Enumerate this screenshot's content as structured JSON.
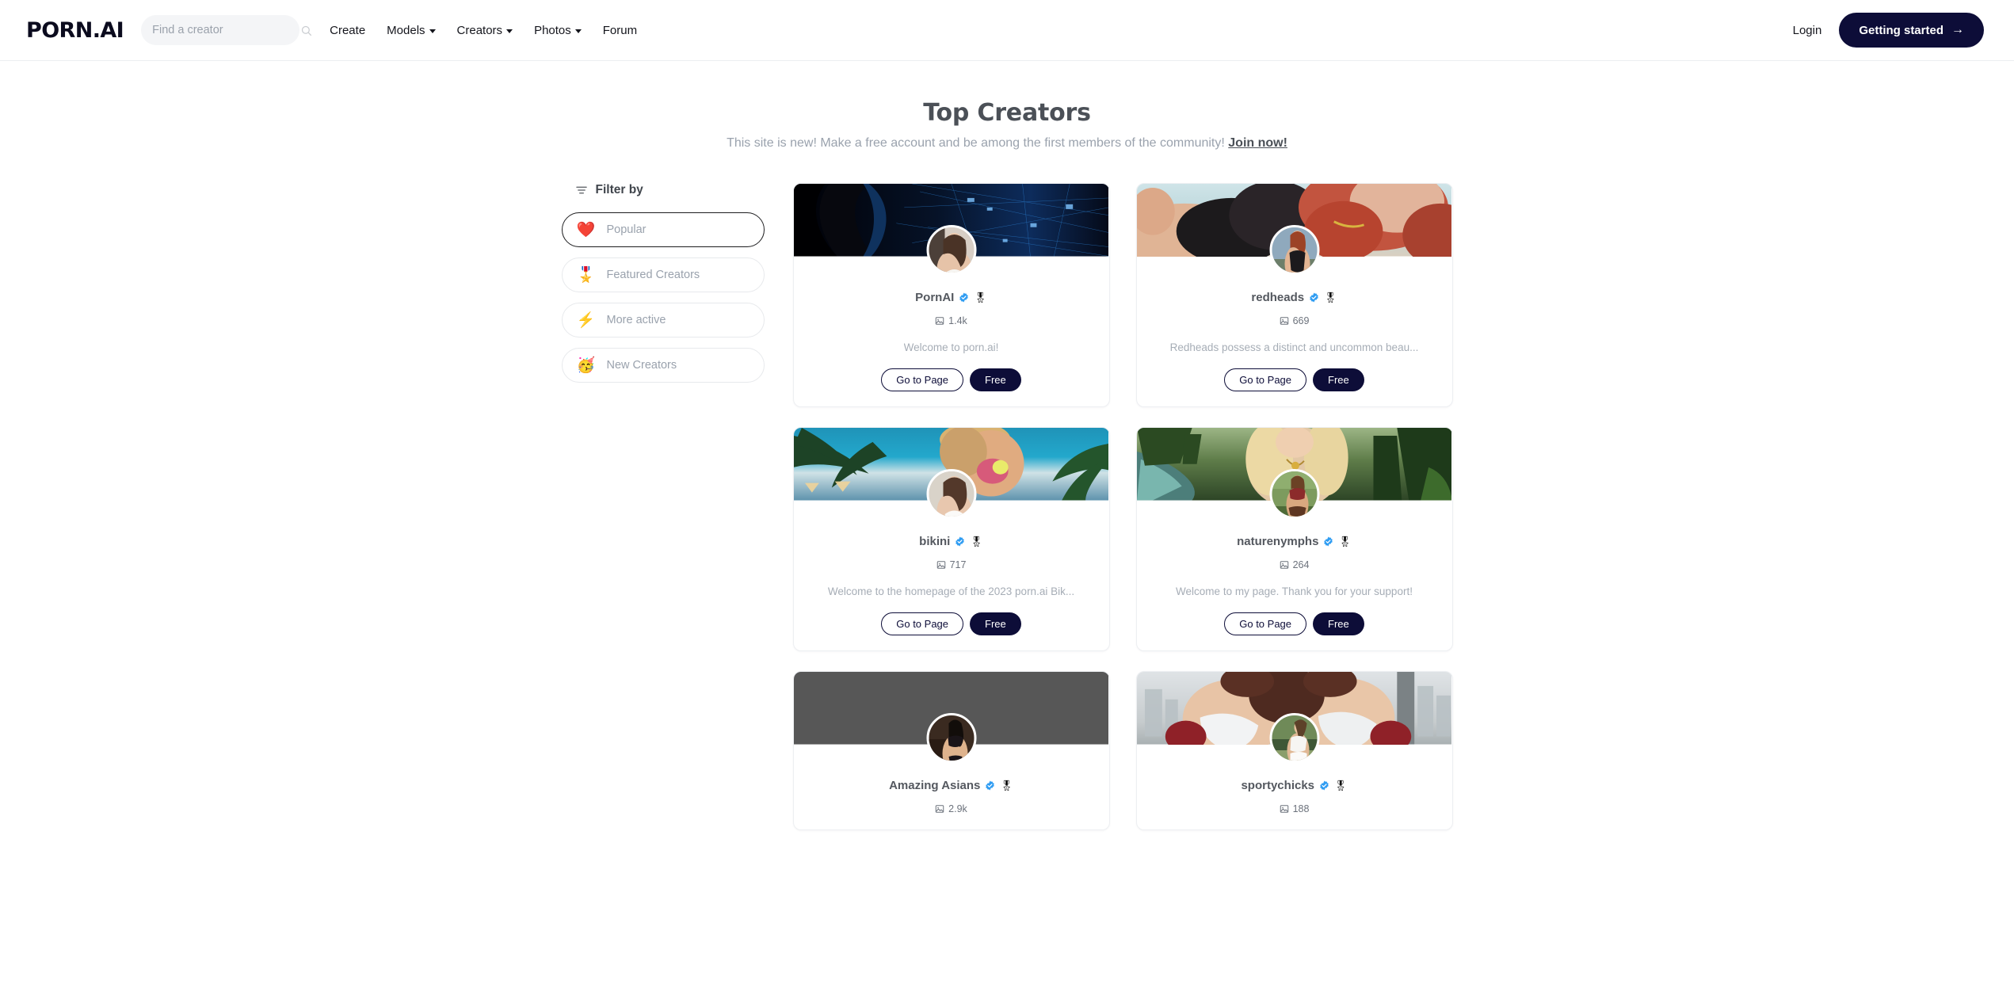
{
  "header": {
    "logo": "PORN.AI",
    "search": {
      "placeholder": "Find a creator",
      "value": ""
    },
    "nav": [
      {
        "label": "Create",
        "has_dropdown": false
      },
      {
        "label": "Models",
        "has_dropdown": true
      },
      {
        "label": "Creators",
        "has_dropdown": true
      },
      {
        "label": "Photos",
        "has_dropdown": true
      },
      {
        "label": "Forum",
        "has_dropdown": false
      }
    ],
    "login_label": "Login",
    "cta_label": "Getting started",
    "cta_arrow": "→"
  },
  "page": {
    "title": "Top Creators",
    "subtitle": "This site is new! Make a free account and be among the first members of the community!",
    "subtitle_link": "Join now!"
  },
  "filter": {
    "heading": "Filter by",
    "options": [
      {
        "label": "Popular",
        "emoji": "❤️",
        "icon_name": "heart-emoji",
        "active": true
      },
      {
        "label": "Featured Creators",
        "emoji": "🎖️",
        "icon_name": "medal-emoji",
        "active": false
      },
      {
        "label": "More active",
        "emoji": "⚡",
        "icon_name": "lightning-emoji",
        "active": false
      },
      {
        "label": "New Creators",
        "emoji": "🥳",
        "icon_name": "new-creators-emoji",
        "active": false
      }
    ]
  },
  "buttons": {
    "go_to_page": "Go to Page",
    "free": "Free"
  },
  "colors": {
    "accent_dark": "#0d0d38",
    "verified_blue": "#2e9cf2",
    "medal_gold": "#f5c430",
    "muted_text": "#a6adb6",
    "page_bg": "#ffffff"
  },
  "creators": [
    {
      "name": "PornAI",
      "verified": true,
      "featured": true,
      "photo_count": "1.4k",
      "description": "Welcome to porn.ai!",
      "banner_style": "dark-ai-network",
      "avatar_style": "brunette-white-top"
    },
    {
      "name": "redheads",
      "verified": true,
      "featured": true,
      "photo_count": "669",
      "description": "Redheads possess a distinct and uncommon beau...",
      "banner_style": "redhead-beach",
      "avatar_style": "redhead-corset"
    },
    {
      "name": "bikini",
      "verified": true,
      "featured": true,
      "photo_count": "717",
      "description": "Welcome to the homepage of the 2023 porn.ai Bik...",
      "banner_style": "tropical-beach",
      "avatar_style": "brunette-white-bikini"
    },
    {
      "name": "naturenymphs",
      "verified": true,
      "featured": true,
      "photo_count": "264",
      "description": "Welcome to my page. Thank you for your support!",
      "banner_style": "forest-river",
      "avatar_style": "nature-warrior"
    },
    {
      "name": "Amazing Asians",
      "verified": true,
      "featured": true,
      "photo_count": "2.9k",
      "description": "",
      "banner_style": "solid-gray",
      "avatar_style": "dark-lingerie"
    },
    {
      "name": "sportychicks",
      "verified": true,
      "featured": true,
      "photo_count": "188",
      "description": "",
      "banner_style": "boxing-city",
      "avatar_style": "sporty-white"
    }
  ]
}
